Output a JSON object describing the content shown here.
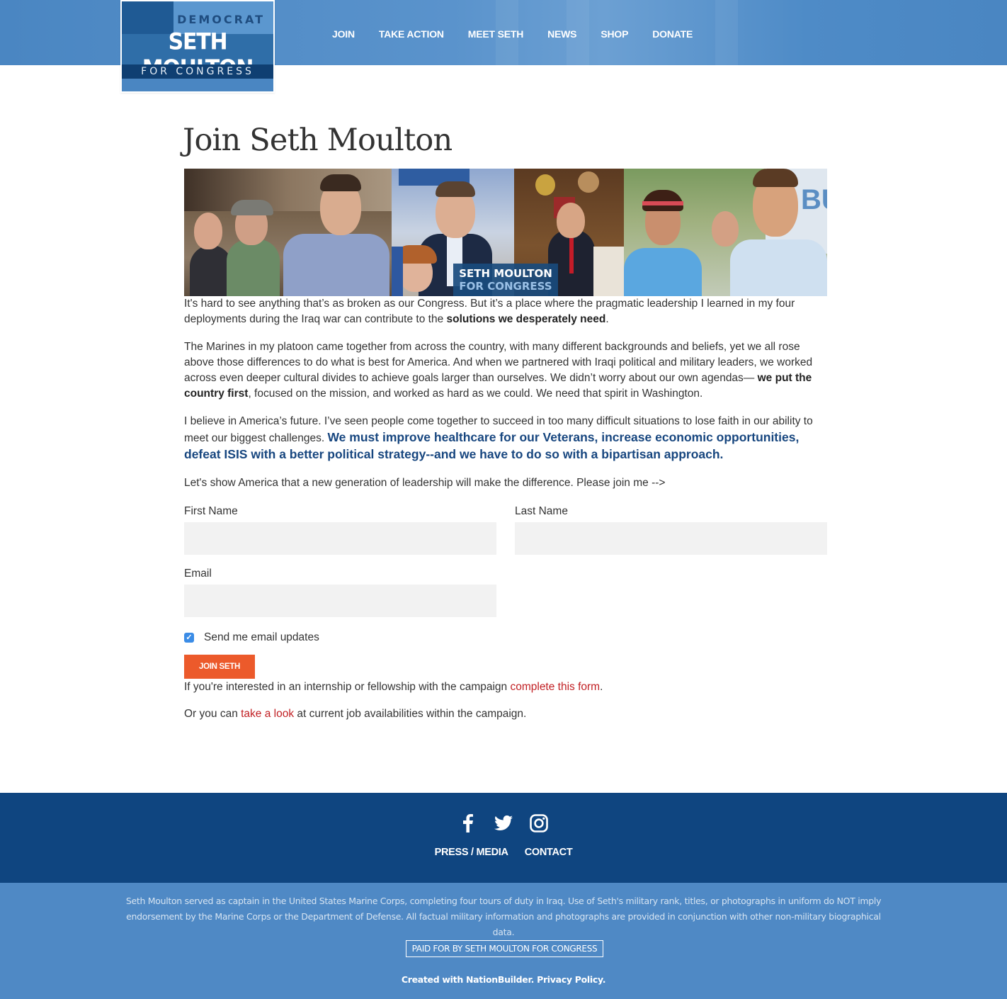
{
  "colors": {
    "header_blue": "#4a86c2",
    "footer_dark_blue": "#0f4580",
    "footer_light_blue": "#4f89c5",
    "accent_orange": "#ec5a2b",
    "link_red": "#c11f23",
    "highlight_blue": "#17467f"
  },
  "logo": {
    "line1": "DEMOCRAT",
    "line2": "SETH MOULTON",
    "line3": "FOR CONGRESS"
  },
  "nav": {
    "items": [
      {
        "label": "JOIN"
      },
      {
        "label": "TAKE ACTION"
      },
      {
        "label": "MEET SETH"
      },
      {
        "label": "NEWS"
      },
      {
        "label": "SHOP"
      },
      {
        "label": "DONATE"
      }
    ]
  },
  "page": {
    "title": "Join Seth Moulton",
    "banner_badge": {
      "line1": "SETH MOULTON",
      "line2": "FOR CONGRESS"
    },
    "paragraphs": {
      "p1_text": "It's hard to see anything that’s as broken as our Congress. But it’s a place where the pragmatic leadership I learned in my four deployments during the Iraq war can contribute to the ",
      "p1_bold": "solutions we desperately need",
      "p1_end": ".",
      "p2_text": "The Marines in my platoon came together from across the country, with many different backgrounds and beliefs, yet we all rose above those differences to do what is best for America. And when we partnered with Iraqi political and military leaders, we worked across even deeper cultural divides to achieve goals larger than ourselves. We didn’t worry about our own agendas— ",
      "p2_bold": "we put the country first",
      "p2_end": ", focused on the mission, and worked as hard as we could. We need that spirit in Washington.",
      "p3_text": "I believe in America’s future. I’ve seen people come together to succeed in too many difficult situations to lose faith in our ability to meet our biggest challenges. ",
      "p3_highlight": "We must improve healthcare for our Veterans, increase economic opportunities, defeat ISIS with a better political strategy--and we have to do so with a bipartisan approach.",
      "p4_text": "Let's show America that a new generation of leadership will make the difference. Please join me -->"
    }
  },
  "form": {
    "first_name_label": "First Name",
    "first_name_value": "",
    "last_name_label": "Last Name",
    "last_name_value": "",
    "email_label": "Email",
    "email_value": "",
    "checkbox_label": "Send me email updates",
    "checkbox_checked": true,
    "submit_label": "JOIN SETH"
  },
  "after_form": {
    "internship_text": "If you're interested in an internship or fellowship with the campaign ",
    "internship_link": "complete this form",
    "internship_end": ".",
    "jobs_text_start": "Or you can ",
    "jobs_link": "take a look",
    "jobs_text_end": " at current job availabilities within the campaign."
  },
  "footer": {
    "social": [
      {
        "icon": "facebook-icon"
      },
      {
        "icon": "twitter-icon"
      },
      {
        "icon": "instagram-icon"
      }
    ],
    "links": [
      {
        "label": "PRESS / MEDIA"
      },
      {
        "label": "CONTACT"
      }
    ],
    "disclaimer": "Seth Moulton served as captain in the United States Marine Corps, completing four tours of duty in Iraq. Use of Seth's military rank, titles, or photographs in uniform do NOT imply endorsement by the Marine Corps or the Department of Defense. All factual military information and photographs are provided in conjunction with other non-military biographical data.",
    "paid_for": "PAID FOR BY SETH MOULTON FOR CONGRESS",
    "created_with_text": "Created with ",
    "nationbuilder_link": "NationBuilder",
    "privacy_link": "Privacy Policy"
  }
}
